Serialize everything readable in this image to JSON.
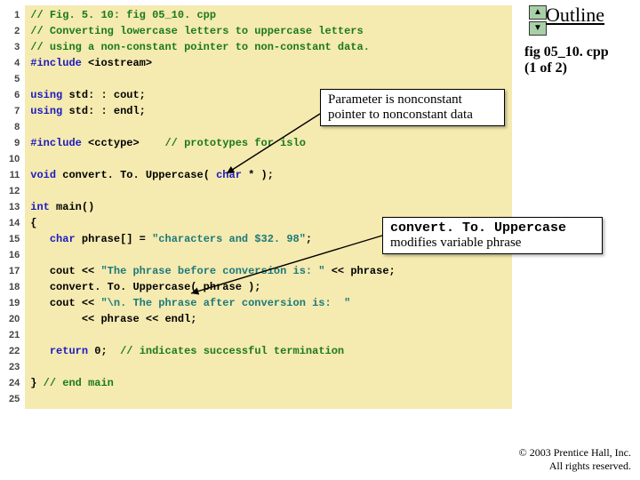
{
  "header": {
    "outline": "Outline"
  },
  "fileinfo": {
    "name": "fig 05_10. cpp",
    "part": "(1 of 2)"
  },
  "nav": {
    "up": "▲",
    "down": "▼"
  },
  "gutter": " 1\n 2\n 3\n 4\n 5\n 6\n 7\n 8\n 9\n10\n11\n12\n13\n14\n15\n16\n17\n18\n19\n20\n21\n22\n23\n24\n25",
  "code": {
    "l1": "// Fig. 5. 10: fig 05_10. cpp",
    "l2": "// Converting lowercase letters to uppercase letters",
    "l3": "// using a non-constant pointer to non-constant data.",
    "l4a": "#include",
    "l4b": " <iostream>",
    "l6a": "using",
    "l6b": " std: : cout;",
    "l7a": "using",
    "l7b": " std: : endl;",
    "l9a": "#include",
    "l9b": " <cctype>    ",
    "l9c": "// prototypes for islo",
    "l11a": "void",
    "l11b": " convert. To. Uppercase( ",
    "l11c": "char",
    "l11d": " * );",
    "l13a": "int",
    "l13b": " main()",
    "l14": "{",
    "l15a": "   ",
    "l15b": "char",
    "l15c": " phrase[] = ",
    "l15d": "\"characters and $32. 98\"",
    "l15e": ";",
    "l17a": "   cout << ",
    "l17b": "\"The phrase before conversion is: \"",
    "l17c": " << phrase;",
    "l18": "   convert. To. Uppercase( phrase );",
    "l19a": "   cout << ",
    "l19b": "\"\\n. The phrase after conversion is:  \"",
    "l20a": "        << phrase << endl;",
    "l22a": "   ",
    "l22b": "return",
    "l22c": " ",
    "l22d": "0",
    "l22e": ";  ",
    "l22f": "// indicates successful termination",
    "l24a": "} ",
    "l24b": "// end main"
  },
  "callouts": {
    "c1": "Parameter is nonconstant pointer to nonconstant data",
    "c2a": "convert. To. Uppercase",
    "c2b": " modifies variable phrase"
  },
  "footer": {
    "copy": "© 2003 Prentice Hall, Inc.",
    "rights": "All rights reserved."
  }
}
